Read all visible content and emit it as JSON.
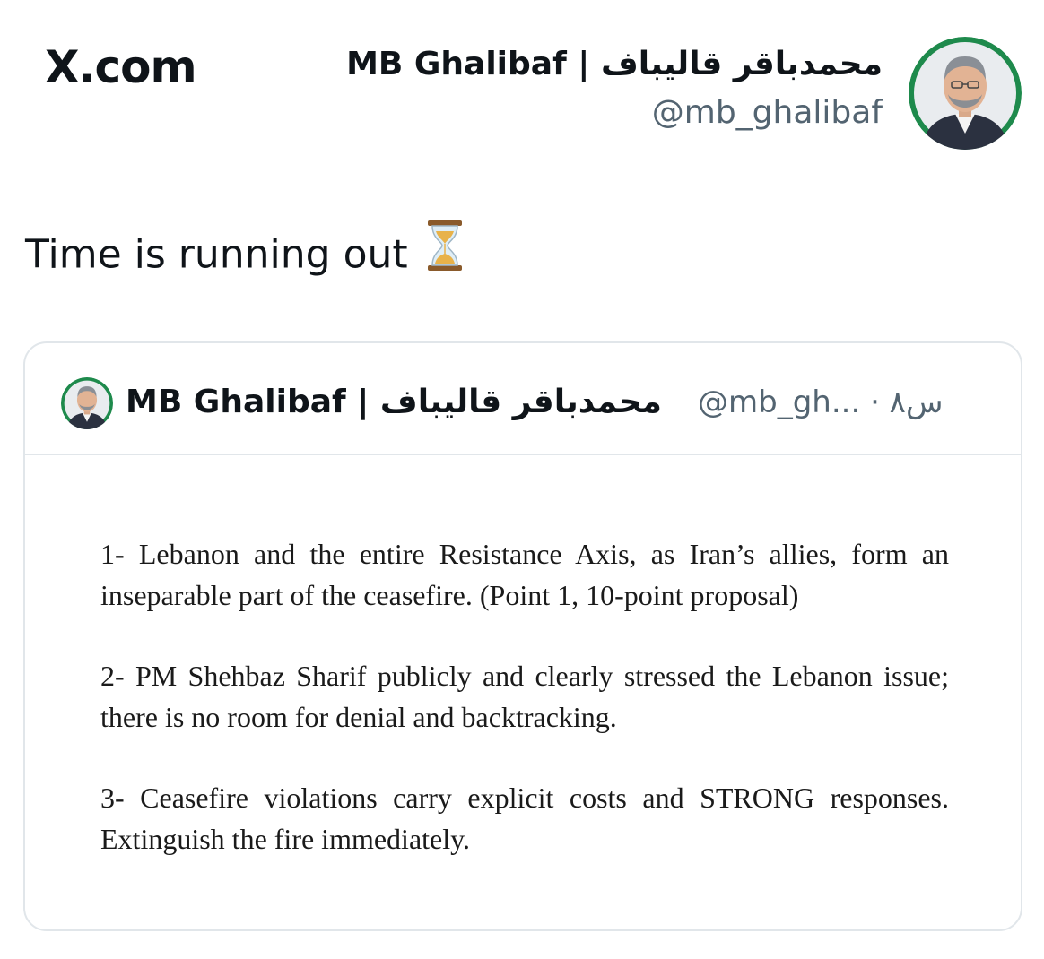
{
  "header": {
    "site_label": "X.com"
  },
  "author": {
    "display_name": "MB Ghalibaf | محمدباقر قالیباف",
    "handle": "@mb_ghalibaf",
    "avatar_icon": "portrait-avatar-icon"
  },
  "tweet": {
    "text": "Time is running out",
    "emoji_icon": "hourglass-icon"
  },
  "quoted_tweet": {
    "display_name": "MB Ghalibaf | محمدباقر قالیباف",
    "meta": "@mb_gh... · ۸س",
    "paragraphs": [
      "1- Lebanon and the entire Resistance Axis, as Iran’s allies, form an inseparable part of the ceasefire. (Point 1, 10-point proposal)",
      "2- PM Shehbaz Sharif publicly and clearly stressed the Lebanon issue; there is no room for denial and backtracking.",
      "3- Ceasefire violations carry explicit costs and STRONG responses. Extinguish the fire immediately."
    ]
  },
  "colors": {
    "avatar_ring": "#1e8a4c",
    "handle_gray": "#536471",
    "card_border": "#e1e6ea"
  }
}
